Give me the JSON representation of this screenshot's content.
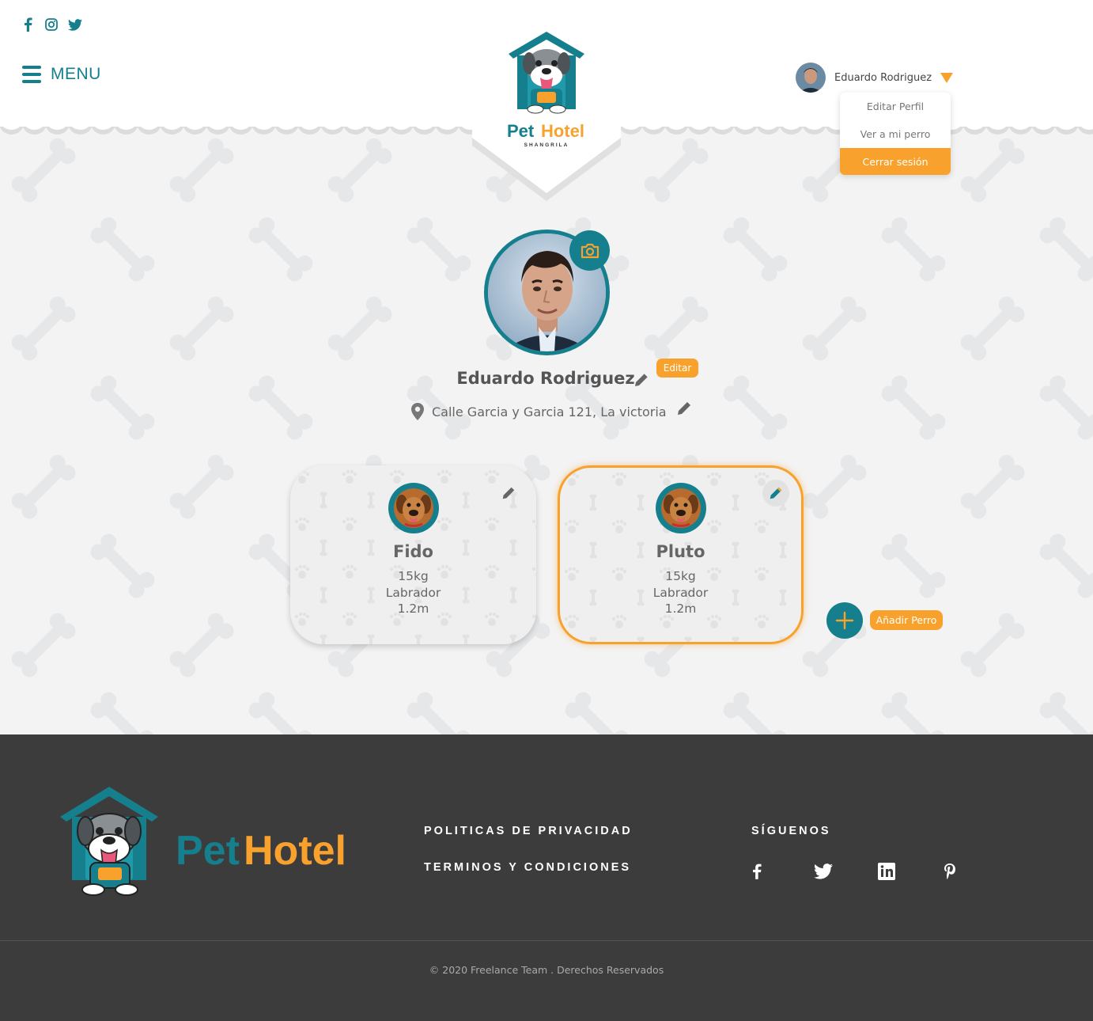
{
  "header": {
    "menu_label": "MENU",
    "social": [
      "facebook-icon",
      "instagram-icon",
      "twitter-icon"
    ],
    "logo": {
      "word1": "Pet",
      "word2": "Hotel",
      "subtitle": "SHANGRILA"
    },
    "user": {
      "name": "Eduardo Rodriguez"
    },
    "dropdown": [
      {
        "label": "Editar Perfil",
        "active": false
      },
      {
        "label": "Ver a mi perro",
        "active": false
      },
      {
        "label": "Cerrar sesión",
        "active": true
      }
    ]
  },
  "profile": {
    "name": "Eduardo Rodriguez",
    "edit_label": "Editar",
    "address": "Calle Garcia y Garcia 121, La victoria"
  },
  "dogs": [
    {
      "name": "Fido",
      "weight": "15kg",
      "breed": "Labrador",
      "height": "1.2m",
      "selected": false
    },
    {
      "name": "Pluto",
      "weight": "15kg",
      "breed": "Labrador",
      "height": "1.2m",
      "selected": true
    }
  ],
  "add_dog_label": "Añadir Perro",
  "footer": {
    "logo": {
      "word1": "Pet",
      "word2": "Hotel"
    },
    "links": [
      "POLITICAS DE PRIVACIDAD",
      "TERMINOS Y CONDICIONES"
    ],
    "follow_title": "SÍGUENOS",
    "social": [
      "facebook-icon",
      "twitter-icon",
      "linkedin-icon",
      "pinterest-icon"
    ],
    "copyright": "© 2020 Freelance Team . Derechos Reservados"
  },
  "colors": {
    "primary": "#167f8d",
    "accent": "#f8a22d",
    "footer_bg": "#3c3c3c",
    "page_bg": "#f2f2f2"
  }
}
